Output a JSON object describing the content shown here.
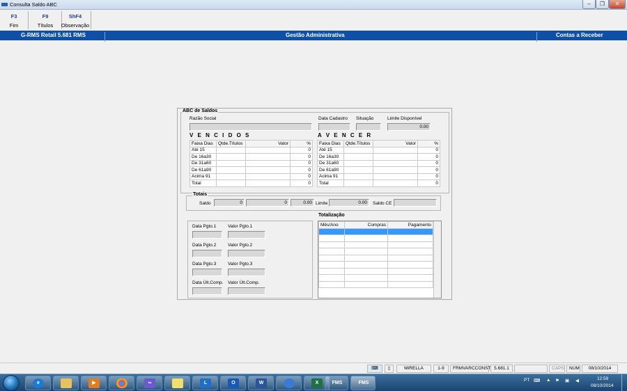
{
  "window": {
    "title": "Consulta Saldo ABC"
  },
  "toolbar": [
    {
      "key": "F3",
      "label": "Fim"
    },
    {
      "key": "F9",
      "label": "Títulos"
    },
    {
      "key": "ShF4",
      "label": "Observação"
    }
  ],
  "infobar": {
    "left": "G-RMS Retail 5.681 RMS",
    "center": "Gestão Administrativa",
    "right": "Contas a Receber"
  },
  "abc": {
    "group_title": "ABC de Saldos",
    "razao_social_label": "Razão Social",
    "data_cadastro_label": "Data Cadastro",
    "situacao_label": "Situação",
    "limite_disponivel_label": "Limite Disponível",
    "limite_disponivel_value": "0.00"
  },
  "vencidos": {
    "title": "V E N C I D O S",
    "columns": [
      "Faixa Dias",
      "Qtde.Títulos",
      "Valor",
      "%"
    ],
    "rows": [
      {
        "faixa": "Até 15",
        "pct": "0"
      },
      {
        "faixa": "De 16a30",
        "pct": "0"
      },
      {
        "faixa": "De 31a60",
        "pct": "0"
      },
      {
        "faixa": "De 61a90",
        "pct": "0"
      },
      {
        "faixa": "Acima 91",
        "pct": "0"
      },
      {
        "faixa": "Total",
        "pct": "0"
      }
    ]
  },
  "avencer": {
    "title": "A  V E N C E R",
    "columns": [
      "Faixa Dias",
      "Qtde.Títulos",
      "Valor",
      "%"
    ],
    "rows": [
      {
        "faixa": "Até 15",
        "pct": "0"
      },
      {
        "faixa": "De 16a30",
        "pct": "0"
      },
      {
        "faixa": "De 31a60",
        "pct": "0"
      },
      {
        "faixa": "De 61a90",
        "pct": "0"
      },
      {
        "faixa": "Acima 91",
        "pct": "0"
      },
      {
        "faixa": "Total",
        "pct": "0"
      }
    ]
  },
  "totais": {
    "title": "Totais",
    "saldo_label": "Saldo",
    "saldo_value1": "0",
    "saldo_value2": "0",
    "saldo_value3": "0.00",
    "limite_label": "Limite",
    "limite_value": "0.00",
    "saldo_ce_label": "Saldo CE"
  },
  "pagamentos": {
    "data_pgto1": "Data Pgto.1",
    "valor_pgto1": "Valor Pgto.1",
    "data_pgto2": "Data Pgto.2",
    "valor_pgto2": "Valor Pgto.2",
    "data_pgto3": "Data Pgto.3",
    "valor_pgto3": "Valor Pgto.3",
    "data_ult": "Data Últ.Comp.",
    "valor_ult": "Valor Últ.Comp."
  },
  "totalizacao": {
    "title": "Totalização",
    "columns": [
      "Mês/Ano",
      "Compras",
      "Pagamento"
    ]
  },
  "statusbar": {
    "user": "MIRELLA",
    "page": "1-9",
    "form": "FRMVARCCONST",
    "version": "5.681.1",
    "caps": "CAPS",
    "num": "NUM",
    "date": "08/10/2014"
  },
  "taskbar": {
    "fms1": "FMS",
    "fms2": "FMS",
    "lang": "PT",
    "time": "12:59",
    "date": "08/10/2014"
  }
}
